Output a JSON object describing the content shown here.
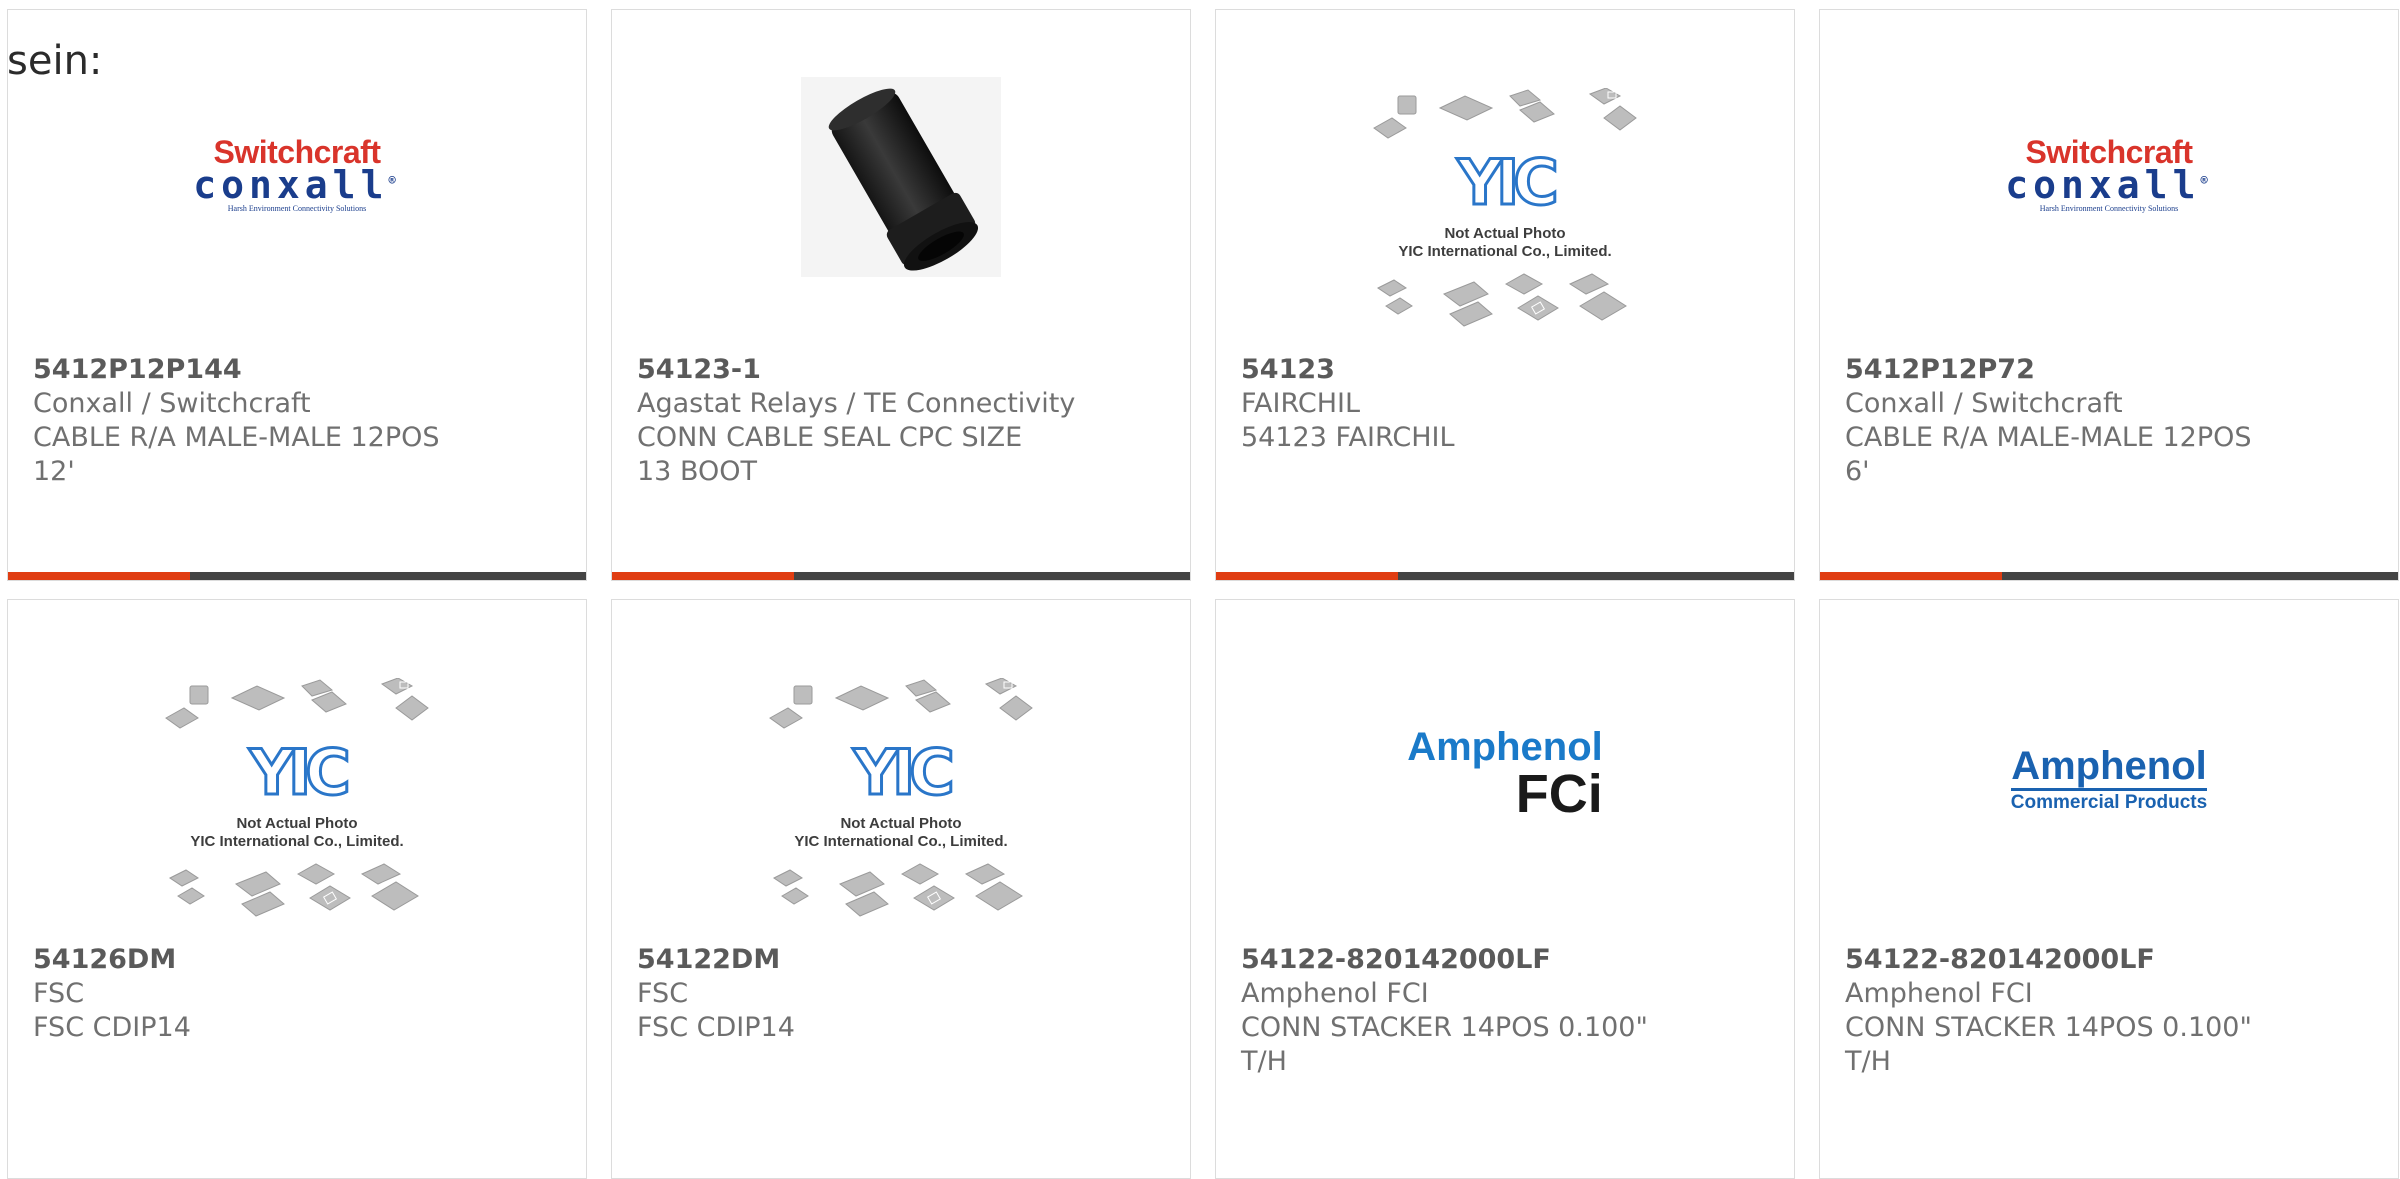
{
  "intro_text": "sein:",
  "placeholder": {
    "line1": "Not Actual Photo",
    "line2": "YIC International Co., Limited."
  },
  "logos": {
    "switchcraft_top": "Switchcraft",
    "switchcraft_mid": "conxall",
    "switchcraft_tagline": "Harsh Environment Connectivity Solutions",
    "amphenol": "Amphenol",
    "fci": "FCi",
    "commercial_products": "Commercial Products"
  },
  "products": [
    {
      "part": "5412P12P144",
      "manufacturer": "Conxall / Switchcraft",
      "description": "CABLE R/A MALE-MALE 12POS 12'",
      "image": "switchcraft-logo"
    },
    {
      "part": "54123-1",
      "manufacturer": "Agastat Relays / TE Connectivity",
      "description": "CONN CABLE SEAL CPC SIZE 13 BOOT",
      "image": "cable-boot-photo"
    },
    {
      "part": "54123",
      "manufacturer": "FAIRCHIL",
      "description": "54123 FAIRCHIL",
      "image": "yic-placeholder"
    },
    {
      "part": "5412P12P72",
      "manufacturer": "Conxall / Switchcraft",
      "description": "CABLE R/A MALE-MALE 12POS 6'",
      "image": "switchcraft-logo"
    },
    {
      "part": "54126DM",
      "manufacturer": "FSC",
      "description": "FSC CDIP14",
      "image": "yic-placeholder"
    },
    {
      "part": "54122DM",
      "manufacturer": "FSC",
      "description": "FSC CDIP14",
      "image": "yic-placeholder"
    },
    {
      "part": "54122-820142000LF",
      "manufacturer": "Amphenol FCI",
      "description": "CONN STACKER 14POS 0.100\" T/H",
      "image": "amphenol-fci-logo"
    },
    {
      "part": "54122-820142000LF",
      "manufacturer": "Amphenol FCI",
      "description": "CONN STACKER 14POS 0.100\" T/H",
      "image": "amphenol-commercial-logo"
    }
  ],
  "colors": {
    "accent": "#e03d12",
    "bar": "#444444",
    "border": "#dcdcdc"
  }
}
